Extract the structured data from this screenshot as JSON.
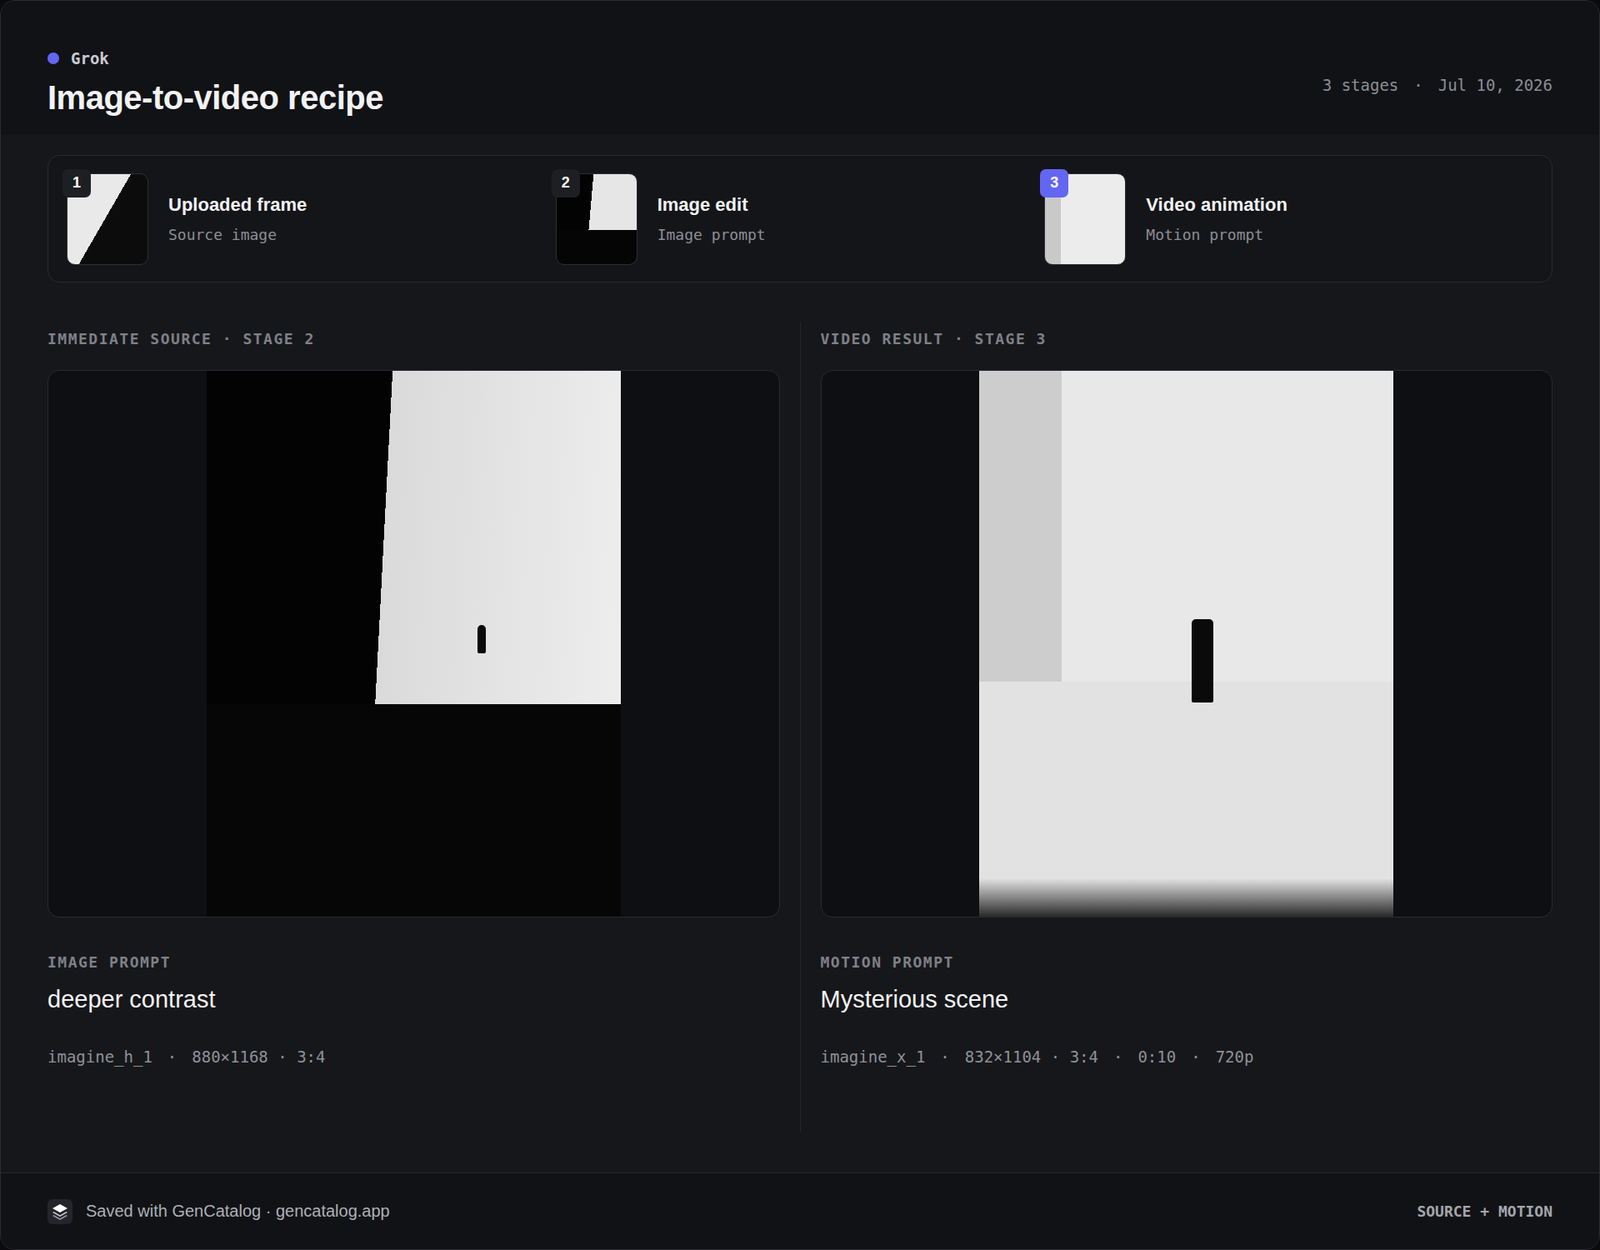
{
  "header": {
    "brand": "Grok",
    "title": "Image-to-video recipe",
    "meta": [
      "3 stages",
      "Jul 10, 2026"
    ],
    "separator": "·"
  },
  "stages": [
    {
      "number": "1",
      "title": "Uploaded frame",
      "subtitle": "Source image",
      "selected": false
    },
    {
      "number": "2",
      "title": "Image edit",
      "subtitle": "Image prompt",
      "selected": false
    },
    {
      "number": "3",
      "title": "Video animation",
      "subtitle": "Motion prompt",
      "selected": true
    }
  ],
  "panels": [
    {
      "label": "IMMEDIATE SOURCE · STAGE 2",
      "prompt_label": "IMAGE PROMPT",
      "prompt": "deeper contrast",
      "meta": [
        "imagine_h_1",
        "880×1168 · 3:4"
      ]
    },
    {
      "label": "VIDEO RESULT · STAGE 3",
      "prompt_label": "MOTION PROMPT",
      "prompt": "Mysterious scene",
      "meta": [
        "imagine_x_1",
        "832×1104 · 3:4",
        "0:10",
        "720p"
      ]
    }
  ],
  "footer": {
    "text": "Saved with GenCatalog · gencatalog.app",
    "tag": "SOURCE + MOTION"
  }
}
